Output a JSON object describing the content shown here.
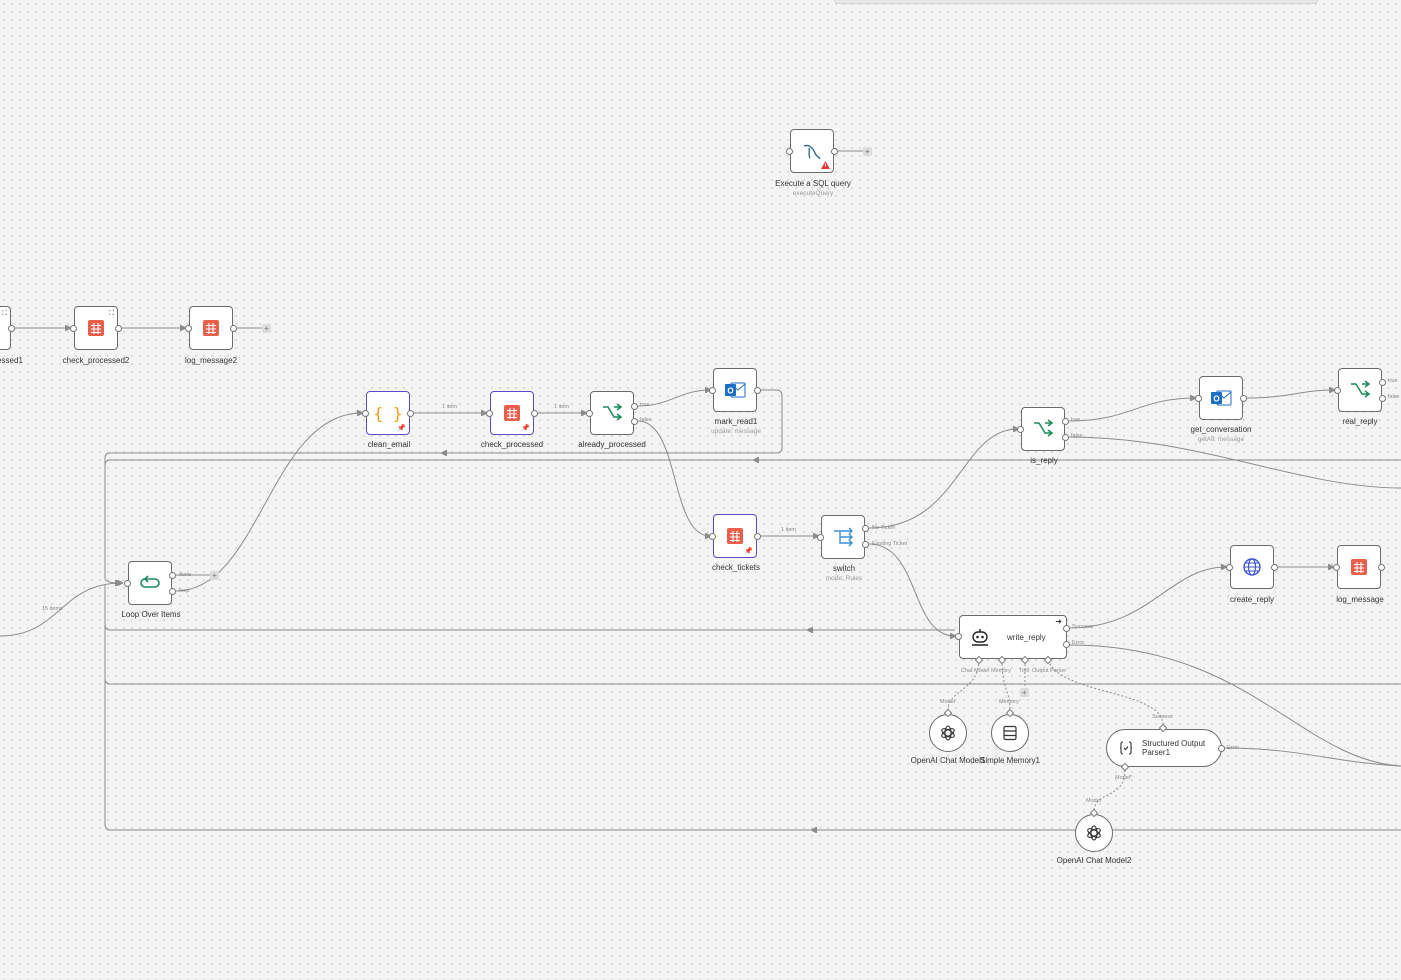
{
  "colors": {
    "canvas": "#f4f4f4",
    "edge": "#8c8c8c",
    "pinned_border": "#5a4cc7",
    "sheets_red": "#e8604c",
    "if_green": "#1c8a5a",
    "outlook_blue": "#1b6ec2",
    "code_orange": "#f39c12",
    "switch_blue": "#3b8fd6",
    "web_blue": "#3e56cf"
  },
  "nodes": {
    "execute_sql": {
      "label": "Execute a SQL query",
      "sub": "executeQuery",
      "icon": "mysql-dolphin-icon"
    },
    "processed1": {
      "label": "essed1",
      "icon": "google-sheets-icon"
    },
    "check_processed2": {
      "label": "check_processed2",
      "icon": "google-sheets-icon"
    },
    "log_message2": {
      "label": "log_message2",
      "icon": "google-sheets-icon"
    },
    "clean_email": {
      "label": "clean_email",
      "icon": "code-braces-icon"
    },
    "check_processed": {
      "label": "check_processed",
      "icon": "google-sheets-icon"
    },
    "already_processed": {
      "label": "already_processed",
      "icon": "if-branch-icon",
      "out_true": "true",
      "out_false": "false"
    },
    "mark_read1": {
      "label": "mark_read1",
      "sub": "update: message",
      "icon": "outlook-icon"
    },
    "is_reply": {
      "label": "is_reply",
      "icon": "if-branch-icon",
      "out_true": "true",
      "out_false": "false"
    },
    "get_conversation": {
      "label": "get_conversation",
      "sub": "getAll: message",
      "icon": "outlook-icon"
    },
    "real_reply": {
      "label": "real_reply",
      "icon": "if-branch-icon",
      "out_true": "true",
      "out_false": "false"
    },
    "check_tickets": {
      "label": "check_tickets",
      "icon": "google-sheets-icon"
    },
    "switch": {
      "label": "switch",
      "sub": "mode: Rules",
      "icon": "switch-icon",
      "out_no_ticket": "No Ticket",
      "out_existing": "Existing Ticket"
    },
    "loop_over_items": {
      "label": "Loop Over Items",
      "icon": "loop-icon",
      "out_done": "done",
      "out_loop": "loop"
    },
    "write_reply": {
      "label": "write_reply",
      "icon": "robot-agent-icon",
      "out_success": "Success",
      "out_error": "Error",
      "ports": [
        "Chat Model",
        "Memory",
        "Tool",
        "Output Parser"
      ]
    },
    "create_reply": {
      "label": "create_reply",
      "icon": "globe-icon"
    },
    "log_message": {
      "label": "log_message",
      "icon": "google-sheets-icon"
    },
    "openai_chat_model1": {
      "label": "OpenAI Chat Model1",
      "icon": "openai-icon",
      "port": "Model"
    },
    "simple_memory1": {
      "label": "Simple Memory1",
      "icon": "memory-stack-icon",
      "port": "Memory"
    },
    "structured_output_parser1": {
      "label": "Structured Output Parser1",
      "line1": "Structured Output",
      "line2": "Parser1",
      "icon": "braces-check-icon",
      "port_top": "Success",
      "port_bottom": "Model*",
      "out_error": "Error"
    },
    "openai_chat_model2": {
      "label": "OpenAI Chat Model2",
      "icon": "openai-icon",
      "port": "Model"
    }
  },
  "edge_labels": {
    "items_1a": "1 item",
    "items_1b": "1 item",
    "items_1c": "1 item",
    "items_15": "15 items"
  }
}
